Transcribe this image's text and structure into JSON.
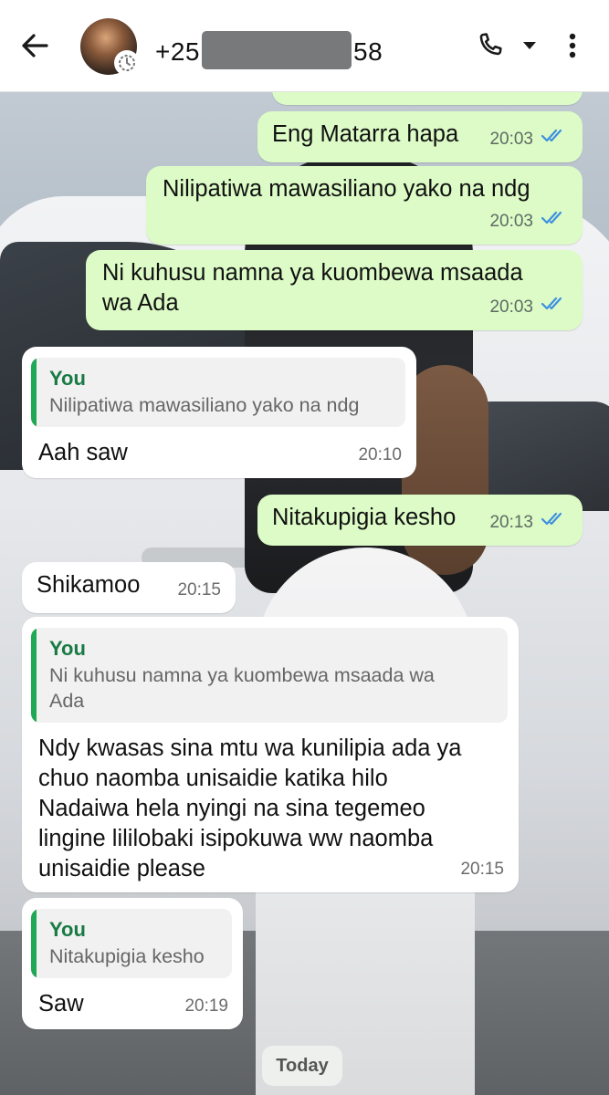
{
  "header": {
    "contact_prefix": "+25",
    "contact_suffix": "58",
    "icons": [
      "back-arrow-icon",
      "avatar",
      "disappearing-timer-icon",
      "phone-icon",
      "dropdown-caret-icon",
      "overflow-menu-icon"
    ]
  },
  "messages": [
    {
      "dir": "out",
      "text": "",
      "time": "20:03",
      "status": "read",
      "partial": true
    },
    {
      "dir": "out",
      "text": "Eng Matarra hapa",
      "time": "20:03",
      "status": "read"
    },
    {
      "dir": "out",
      "text": "Nilipatiwa mawasiliano yako na ndg",
      "time": "20:03",
      "status": "read"
    },
    {
      "dir": "out",
      "lines": [
        "Ni kuhusu namna ya kuombewa msaada",
        "wa Ada"
      ],
      "time": "20:03",
      "status": "read"
    },
    {
      "dir": "in",
      "quote": {
        "name": "You",
        "text": "Nilipatiwa mawasiliano yako na ndg"
      },
      "text": "Aah saw",
      "time": "20:10"
    },
    {
      "dir": "out",
      "text": "Nitakupigia kesho",
      "time": "20:13",
      "status": "read"
    },
    {
      "dir": "in",
      "text": "Shikamoo",
      "time": "20:15"
    },
    {
      "dir": "in",
      "quote": {
        "name": "You",
        "lines": [
          "Ni kuhusu namna ya kuombewa msaada wa",
          "Ada"
        ]
      },
      "lines": [
        "Ndy kwasas sina mtu wa kunilipia ada ya",
        "chuo naomba unisaidie katika hilo",
        "Nadaiwa hela nyingi na sina tegemeo",
        "lingine lililobaki isipokuwa ww naomba",
        "unisaidie please"
      ],
      "time": "20:15"
    },
    {
      "dir": "in",
      "quote": {
        "name": "You",
        "text": "Nitakupigia kesho"
      },
      "text": "Saw",
      "time": "20:19"
    }
  ],
  "date_chip": "Today",
  "colors": {
    "outgoing": "#dcfbc6",
    "incoming": "#ffffff",
    "read_ticks": "#3d8fe0",
    "quote_bar": "#1fa855"
  }
}
